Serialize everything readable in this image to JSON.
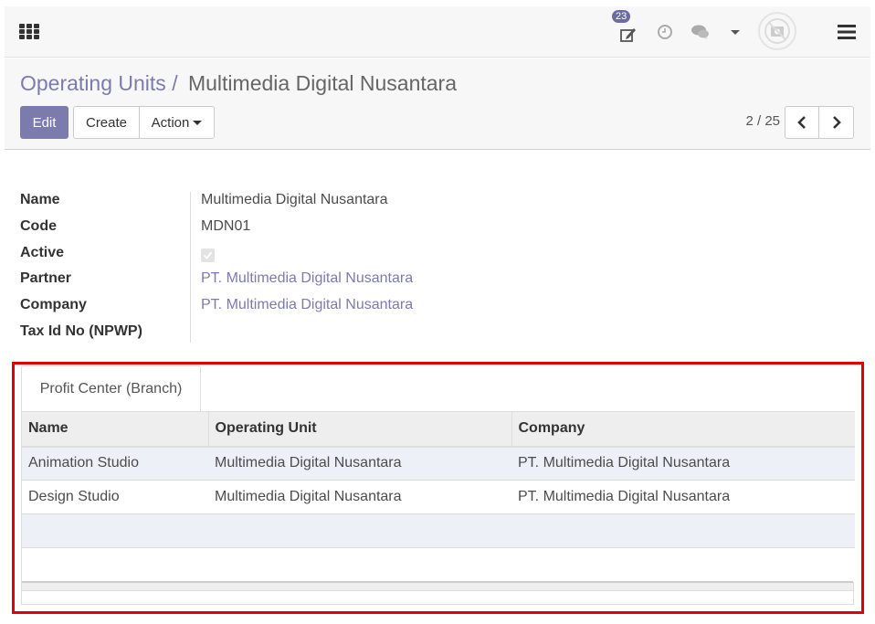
{
  "navbar": {
    "apps_icon": "apps-grid-icon",
    "activity_badge_count": "23",
    "icons": [
      "edit-icon",
      "clock-icon",
      "chat-icon",
      "caret-down-icon",
      "avatar-placeholder-icon",
      "hamburger-menu-icon"
    ]
  },
  "breadcrumb": {
    "parent": "Operating Units",
    "separator": "/",
    "current": "Multimedia Digital Nusantara"
  },
  "toolbar": {
    "edit_label": "Edit",
    "create_label": "Create",
    "action_label": "Action"
  },
  "pager": {
    "value": "2 / 25"
  },
  "form": {
    "fields": [
      {
        "label": "Name",
        "value": "Multimedia Digital Nusantara"
      },
      {
        "label": "Code",
        "value": "MDN01"
      },
      {
        "label": "Active",
        "value": true
      },
      {
        "label": "Partner",
        "value": "PT. Multimedia Digital Nusantara"
      },
      {
        "label": "Company",
        "value": "PT. Multimedia Digital Nusantara"
      },
      {
        "label": "Tax Id No (NPWP)",
        "value": ""
      }
    ]
  },
  "notebook": {
    "tabs": [
      {
        "label": "Profit Center (Branch)"
      }
    ],
    "table": {
      "columns": [
        "Name",
        "Operating Unit",
        "Company"
      ],
      "rows": [
        [
          "Animation Studio",
          "Multimedia Digital Nusantara",
          "PT. Multimedia Digital Nusantara"
        ],
        [
          "Design Studio",
          "Multimedia Digital Nusantara",
          "PT. Multimedia Digital Nusantara"
        ]
      ]
    }
  },
  "colors": {
    "brand": "#7c7bad",
    "highlight": "#e00000",
    "row_alt": "#eef0f8"
  }
}
